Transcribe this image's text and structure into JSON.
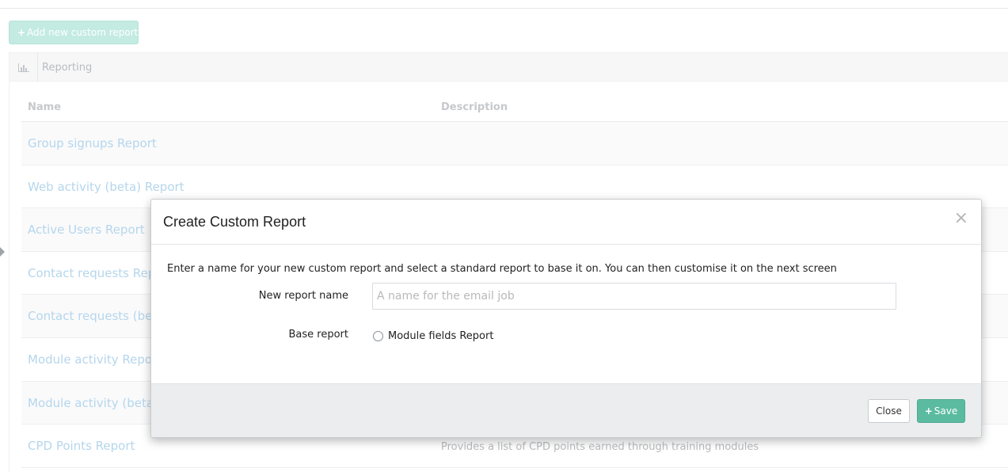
{
  "toolbar": {
    "add_plus": "+",
    "add_label": "Add new custom report"
  },
  "panel": {
    "icon": "bar-chart-icon",
    "title": "Reporting"
  },
  "table": {
    "columns": [
      "Name",
      "Description"
    ],
    "rows": [
      {
        "name": "Group signups Report",
        "description": ""
      },
      {
        "name": "Web activity (beta) Report",
        "description": ""
      },
      {
        "name": "Active Users Report",
        "description": ""
      },
      {
        "name": "Contact requests Repo",
        "description": ""
      },
      {
        "name": "Contact requests (beta",
        "description": ""
      },
      {
        "name": "Module activity Report",
        "description": ""
      },
      {
        "name": "Module activity (beta)",
        "description": ""
      },
      {
        "name": "CPD Points Report",
        "description": "Provides a list of CPD points earned through training modules"
      }
    ]
  },
  "modal": {
    "title": "Create Custom Report",
    "close_icon": "×",
    "intro": "Enter a name for your new custom report and select a standard report to base it on. You can then customise it on the next screen",
    "name_label": "New report name",
    "name_value": "",
    "name_placeholder": "A name for the email job",
    "base_label": "Base report",
    "base_option": "Module fields Report",
    "close_button": "Close",
    "save_plus": "+",
    "save_button": "Save"
  },
  "colors": {
    "accent": "#5bbba0",
    "link_faded": "#b5d6ec"
  }
}
